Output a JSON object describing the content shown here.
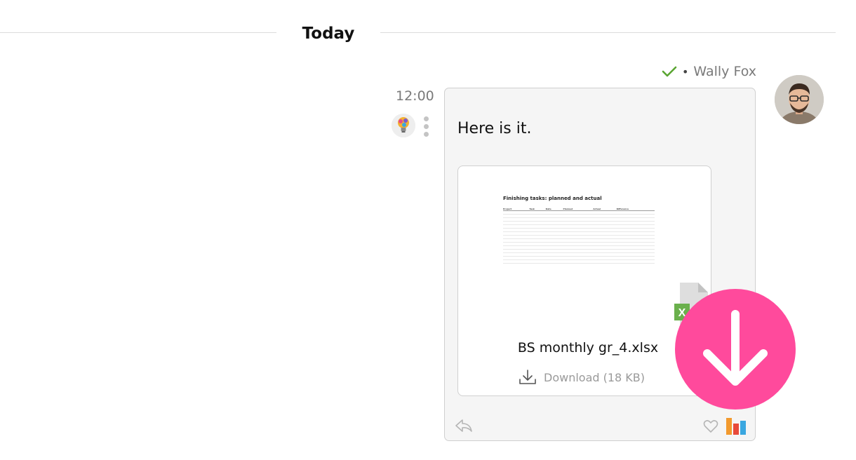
{
  "divider": {
    "label": "Today"
  },
  "message": {
    "sender_name": "Wally Fox",
    "separator": "•",
    "time": "12:00",
    "text": "Here is it.",
    "status": "delivered-check-icon"
  },
  "attachment": {
    "file_name": "BS monthly gr_4.xlsx",
    "download_label": "Download (18 KB)",
    "preview_title": "Finishing tasks: planned and actual",
    "preview_columns": [
      "Project",
      "Task",
      "Date",
      "Planned",
      "Actual",
      "Difference"
    ],
    "file_type_letter": "X"
  },
  "icons": {
    "sender_avatar": "avatar",
    "contact_avatar": "lightbulb-avatar",
    "more": "kebab-menu-icon",
    "reply": "reply-icon",
    "like": "heart-icon",
    "stats": "bar-chart-icon",
    "big_download": "download-arrow-icon"
  },
  "colors": {
    "accent_pink": "#ff4a9c",
    "check_green": "#5aa532",
    "excel_green": "#6ab04c",
    "bar_orange": "#f29a2e",
    "bar_red": "#e84a3a",
    "bar_blue": "#3aa7e0"
  }
}
